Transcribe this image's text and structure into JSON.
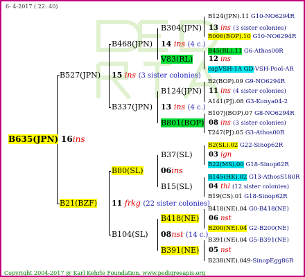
{
  "header": {
    "date": "6- 4-2017 ( 22: 40)"
  },
  "footer": {
    "text": "Copyright 2004-2017 @ Karl Kehrle Foundation.   www.pedigreeapis.org"
  },
  "gen0": {
    "name": "B635(JPN)",
    "year": "16",
    "code": "ins"
  },
  "gen1": [
    {
      "name": "B527(JPN)",
      "year": "15",
      "code": "ins",
      "note": "(3 sister colonies)"
    },
    {
      "name": "B21(BZF)",
      "year": "11",
      "code": "frkg",
      "note": "(22 sister colonies)"
    }
  ],
  "gen2": [
    {
      "name": "B468(JPN)",
      "year": "14",
      "code": "ins",
      "note": "(4 c.)"
    },
    {
      "name": "B337(JPN)",
      "year": "13",
      "code": "ins",
      "note": "(4 c.)"
    },
    {
      "name": "B80(SL)",
      "year": "06",
      "code": "ins"
    },
    {
      "name": "B104(SL)",
      "year": "08",
      "code": "nst",
      "note": "(14 c.)"
    }
  ],
  "gen3": [
    {
      "name": "B304(JPN)",
      "year": "13",
      "code": "ins",
      "note": "(3 sister colonies)"
    },
    {
      "name": "V83(RL)",
      "year": "12",
      "code": "ins"
    },
    {
      "name": "B124(JPN)",
      "year": "11",
      "code": "ins",
      "note": "(4 sister colonies)"
    },
    {
      "name": "B801(BOP)",
      "year": "08",
      "code": "ins",
      "note": "(3 sister colonies)"
    },
    {
      "name": "B37(SL)",
      "year": "03",
      "code": "ign"
    },
    {
      "name": "B15(SL)",
      "year": "04",
      "code": "thl",
      "note": "(12 sister colonies)"
    },
    {
      "name": "B418(NE)",
      "year": "06",
      "code": "nst"
    },
    {
      "name": "B391(NE)",
      "year": "05",
      "code": "nst"
    }
  ],
  "gen4": [
    {
      "name": "B124(JPN)",
      "num": ".11",
      "g": "G10",
      "loc": "-NO6294R"
    },
    {
      "name": "B006(BOP)",
      "num": ".10",
      "g": "G10",
      "loc": "-NO6294R"
    },
    {
      "name": "B45(RL)",
      "num": ".11",
      "g": "G6",
      "loc": "-Athos00R"
    },
    {
      "name": "capVSH-1A",
      "num": "GD",
      "g": "",
      "loc": "-VSH-Pool-AR"
    },
    {
      "name": "B2(BOP)",
      "num": ".09",
      "g": "G9",
      "loc": "-NO6294R"
    },
    {
      "name": "A141(PJ)",
      "num": ".08",
      "g": "G3",
      "loc": "-Konya04-2"
    },
    {
      "name": "B107j(BOP)",
      "num": ".07",
      "g": "G8",
      "loc": "-NO6294R"
    },
    {
      "name": "T247(PJ)",
      "num": ".05",
      "g": "G3",
      "loc": "-Athos00R"
    },
    {
      "name": "B2(SL)",
      "num": ".02",
      "g": "G22",
      "loc": "-Sinop62R"
    },
    {
      "name": "B22(MS)",
      "num": ".00",
      "g": "G18",
      "loc": "-Sinop62R"
    },
    {
      "name": "B145(HK)",
      "num": ".02",
      "g": "G13",
      "loc": "-AthosS180R"
    },
    {
      "name": "B19(CS)",
      "num": ".01",
      "g": "G18",
      "loc": "-Sinop62R"
    },
    {
      "name": "B418(NE)",
      "num": ".04",
      "g": "G0",
      "loc": "-B418(NE)"
    },
    {
      "name": "B200(NE)",
      "num": ".04",
      "g": "G2",
      "loc": "-B200(NE)"
    },
    {
      "name": "B391(NE)",
      "num": ".04",
      "g": "G5",
      "loc": "-B391(NE)"
    },
    {
      "name": "B238(NE)",
      "num": ".049",
      "g": "",
      "loc": "-SinopEgg86R"
    }
  ]
}
